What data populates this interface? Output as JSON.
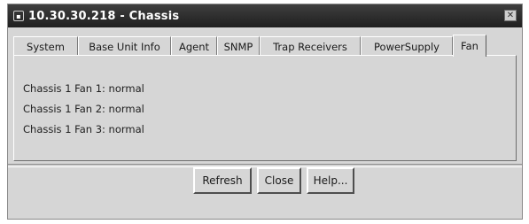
{
  "window": {
    "title": "10.30.30.218 - Chassis",
    "close_glyph": "✕"
  },
  "tabs": [
    {
      "label": "System"
    },
    {
      "label": "Base Unit Info"
    },
    {
      "label": "Agent"
    },
    {
      "label": "SNMP"
    },
    {
      "label": "Trap Receivers"
    },
    {
      "label": "PowerSupply"
    },
    {
      "label": "Fan",
      "active": true
    }
  ],
  "fans": [
    "Chassis 1 Fan 1: normal",
    "Chassis 1 Fan 2: normal",
    "Chassis 1 Fan 3: normal"
  ],
  "buttons": {
    "refresh": "Refresh",
    "close": "Close",
    "help": "Help..."
  }
}
